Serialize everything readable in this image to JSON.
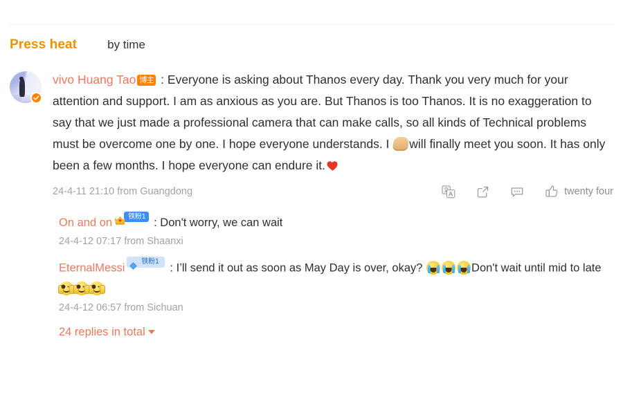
{
  "tabs": {
    "active_label": "Press heat",
    "inactive_label": "by time"
  },
  "post": {
    "author": "vivo Huang Tao",
    "author_badge": "博主",
    "separator": " : ",
    "text_part1": "Everyone is asking about Thanos every day. Thank you very much for your attention and support. I am as anxious as you are. But Thanos is too Thanos. It is no exaggeration to say that we just made a professional camera that can make calls, so all kinds of Technical problems must be overcome one by one. I hope everyone understands. I ",
    "text_part2": "will finally meet you soon. It has only been a few months. I hope everyone can endure it.",
    "emoji_handshake": "handshake-emoji",
    "emoji_heart": "red-heart-emoji",
    "timestamp": "24-4-11 21:10 from Guangdong",
    "actions": {
      "translate": "translate-icon",
      "share": "share-icon",
      "comment": "comment-icon",
      "like_icon": "thumbs-up-icon",
      "like_count": "twenty four"
    }
  },
  "replies": [
    {
      "user": "On and on",
      "badge_icon": "crown-icon",
      "badge_label": "铁粉1",
      "badge_style": "dark",
      "separator": " : ",
      "text": "Don't worry, we can wait",
      "timestamp": "24-4-12 07:17 from Shaanxi"
    },
    {
      "user": "EternalMessi",
      "badge_icon": "diamond-icon",
      "badge_label": "铁粉1",
      "badge_style": "light",
      "separator": " : ",
      "text_part1": "I’ll send it out as soon as May Day is over, okay? ",
      "text_part2": "Don't wait until mid to late",
      "emoji_cry": "loudly-crying-face-emoji",
      "emoji_hug": "hugging-face-emoji",
      "timestamp": "24-4-12 06:57 from Sichuan"
    }
  ],
  "footer": {
    "more_replies": "24 replies in total"
  },
  "colors": {
    "accent_orange": "#f29100",
    "badge_orange": "#ff8200",
    "username_coral": "#f2785c",
    "text_dark": "#2f2f2f",
    "text_muted": "#a3a3a3",
    "badge_blue": "#3d8ef7",
    "badge_blue_light": "#cfe3fb"
  }
}
